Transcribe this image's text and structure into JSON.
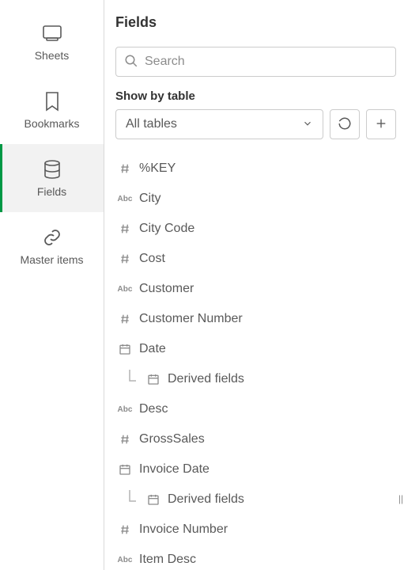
{
  "sidebar": {
    "items": [
      {
        "key": "sheets",
        "label": "Sheets",
        "icon": "sheets-icon",
        "active": false
      },
      {
        "key": "bookmarks",
        "label": "Bookmarks",
        "icon": "bookmark-icon",
        "active": false
      },
      {
        "key": "fields",
        "label": "Fields",
        "icon": "database-icon",
        "active": true
      },
      {
        "key": "master-items",
        "label": "Master items",
        "icon": "link-icon",
        "active": false
      }
    ]
  },
  "panel": {
    "title": "Fields",
    "search": {
      "placeholder": "Search",
      "value": ""
    },
    "show_by_label": "Show by table",
    "table_selector": {
      "selected": "All tables"
    }
  },
  "fields": [
    {
      "type": "numeric",
      "label": "%KEY"
    },
    {
      "type": "text",
      "label": "City"
    },
    {
      "type": "numeric",
      "label": "City Code"
    },
    {
      "type": "numeric",
      "label": "Cost"
    },
    {
      "type": "text",
      "label": "Customer"
    },
    {
      "type": "numeric",
      "label": "Customer Number"
    },
    {
      "type": "date",
      "label": "Date"
    },
    {
      "type": "derived",
      "label": "Derived fields",
      "child": true
    },
    {
      "type": "text",
      "label": "Desc"
    },
    {
      "type": "numeric",
      "label": "GrossSales"
    },
    {
      "type": "date",
      "label": "Invoice Date"
    },
    {
      "type": "derived",
      "label": "Derived fields",
      "child": true
    },
    {
      "type": "numeric",
      "label": "Invoice Number"
    },
    {
      "type": "text",
      "label": "Item Desc"
    }
  ]
}
